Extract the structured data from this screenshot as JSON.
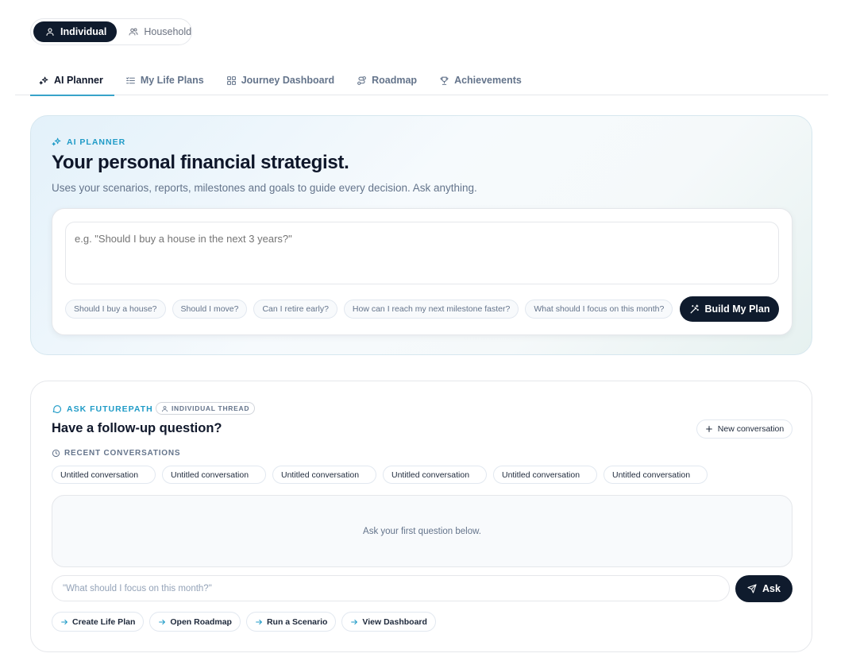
{
  "mode_toggle": {
    "individual": {
      "label": "Individual",
      "icon": "user-icon"
    },
    "household": {
      "label": "Household",
      "icon": "users-icon"
    },
    "selected": "Individual"
  },
  "tabs": [
    {
      "label": "AI Planner",
      "icon": "sparkles-icon",
      "active": true
    },
    {
      "label": "My Life Plans",
      "icon": "list-icon",
      "active": false
    },
    {
      "label": "Journey Dashboard",
      "icon": "grid-icon",
      "active": false
    },
    {
      "label": "Roadmap",
      "icon": "route-icon",
      "active": false
    },
    {
      "label": "Achievements",
      "icon": "trophy-icon",
      "active": false
    }
  ],
  "planner": {
    "eyebrow": "AI PLANNER",
    "title": "Your personal financial strategist.",
    "subtitle": "Uses your scenarios, reports, milestones and goals to guide every decision. Ask anything.",
    "input_placeholder": "e.g. \"Should I buy a house in the next 3 years?\"",
    "suggestions": [
      "Should I buy a house?",
      "Should I move?",
      "Can I retire early?",
      "How can I reach my next milestone faster?",
      "What should I focus on this month?"
    ],
    "build_label": "Build My Plan"
  },
  "ask": {
    "eyebrow": "ASK FUTUREPATH",
    "thread_badge": "INDIVIDUAL THREAD",
    "title": "Have a follow-up question?",
    "new_conversation_label": "New conversation",
    "recent_label": "RECENT CONVERSATIONS",
    "conversations": [
      "Untitled conversation",
      "Untitled conversation",
      "Untitled conversation",
      "Untitled conversation",
      "Untitled conversation",
      "Untitled conversation"
    ],
    "empty_text": "Ask your first question below.",
    "input_placeholder": "\"What should I focus on this month?\"",
    "ask_label": "Ask",
    "quick_links": [
      "Create Life Plan",
      "Open Roadmap",
      "Run a Scenario",
      "View Dashboard"
    ]
  },
  "colors": {
    "accent": "#1f9bc7",
    "primary_dark": "#0f1b2d",
    "muted_text": "#64748b"
  }
}
